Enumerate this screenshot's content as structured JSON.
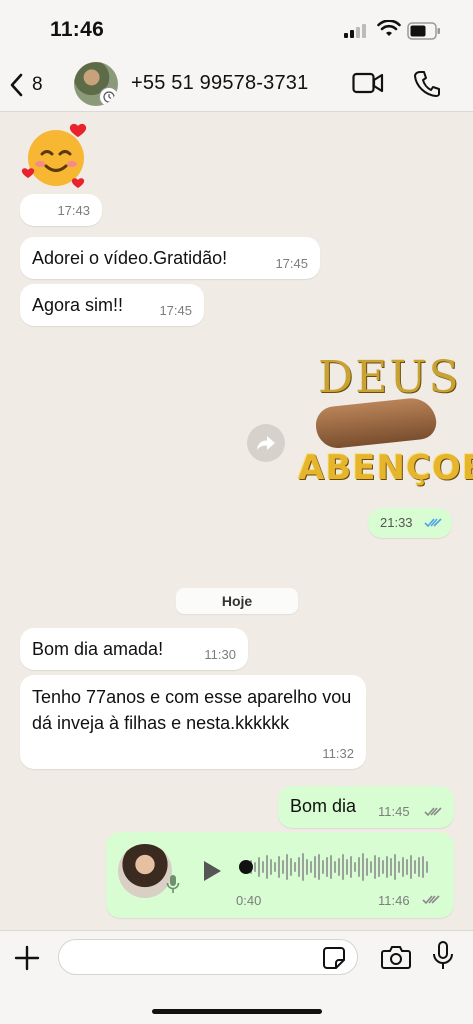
{
  "status": {
    "time": "11:46"
  },
  "header": {
    "back_count": "8",
    "contact": "+55 51 99578-3731"
  },
  "messages": {
    "m1": {
      "emoji": "🥰",
      "time": "17:43"
    },
    "m2": {
      "text": "Adorei o vídeo.Gratidão!",
      "time": "17:45"
    },
    "m3": {
      "text": "Agora sim!!",
      "time": "17:45"
    },
    "sticker": {
      "line1": "DEUS",
      "line2": "ABENÇOE",
      "time": "21:33"
    },
    "day_separator": "Hoje",
    "m4": {
      "text": "Bom dia amada!",
      "time": "11:30"
    },
    "m5": {
      "text": "Tenho 77anos e com esse aparelho vou dá inveja à filhas e nesta.kkkkkk",
      "time": "11:32"
    },
    "m6": {
      "text": "Bom dia",
      "time": "11:45"
    },
    "voice": {
      "duration": "0:40",
      "time": "11:46"
    }
  },
  "colors": {
    "incoming": "#ffffff",
    "outgoing": "#d8fdd2",
    "read_ticks": "#4fa3e8",
    "delivered_ticks": "#8a8a8a"
  },
  "icons": [
    "chevron-left-icon",
    "video-call-icon",
    "phone-icon",
    "forward-icon",
    "double-check-icon",
    "play-icon",
    "microphone-icon",
    "plus-icon",
    "sticker-icon",
    "camera-icon"
  ]
}
